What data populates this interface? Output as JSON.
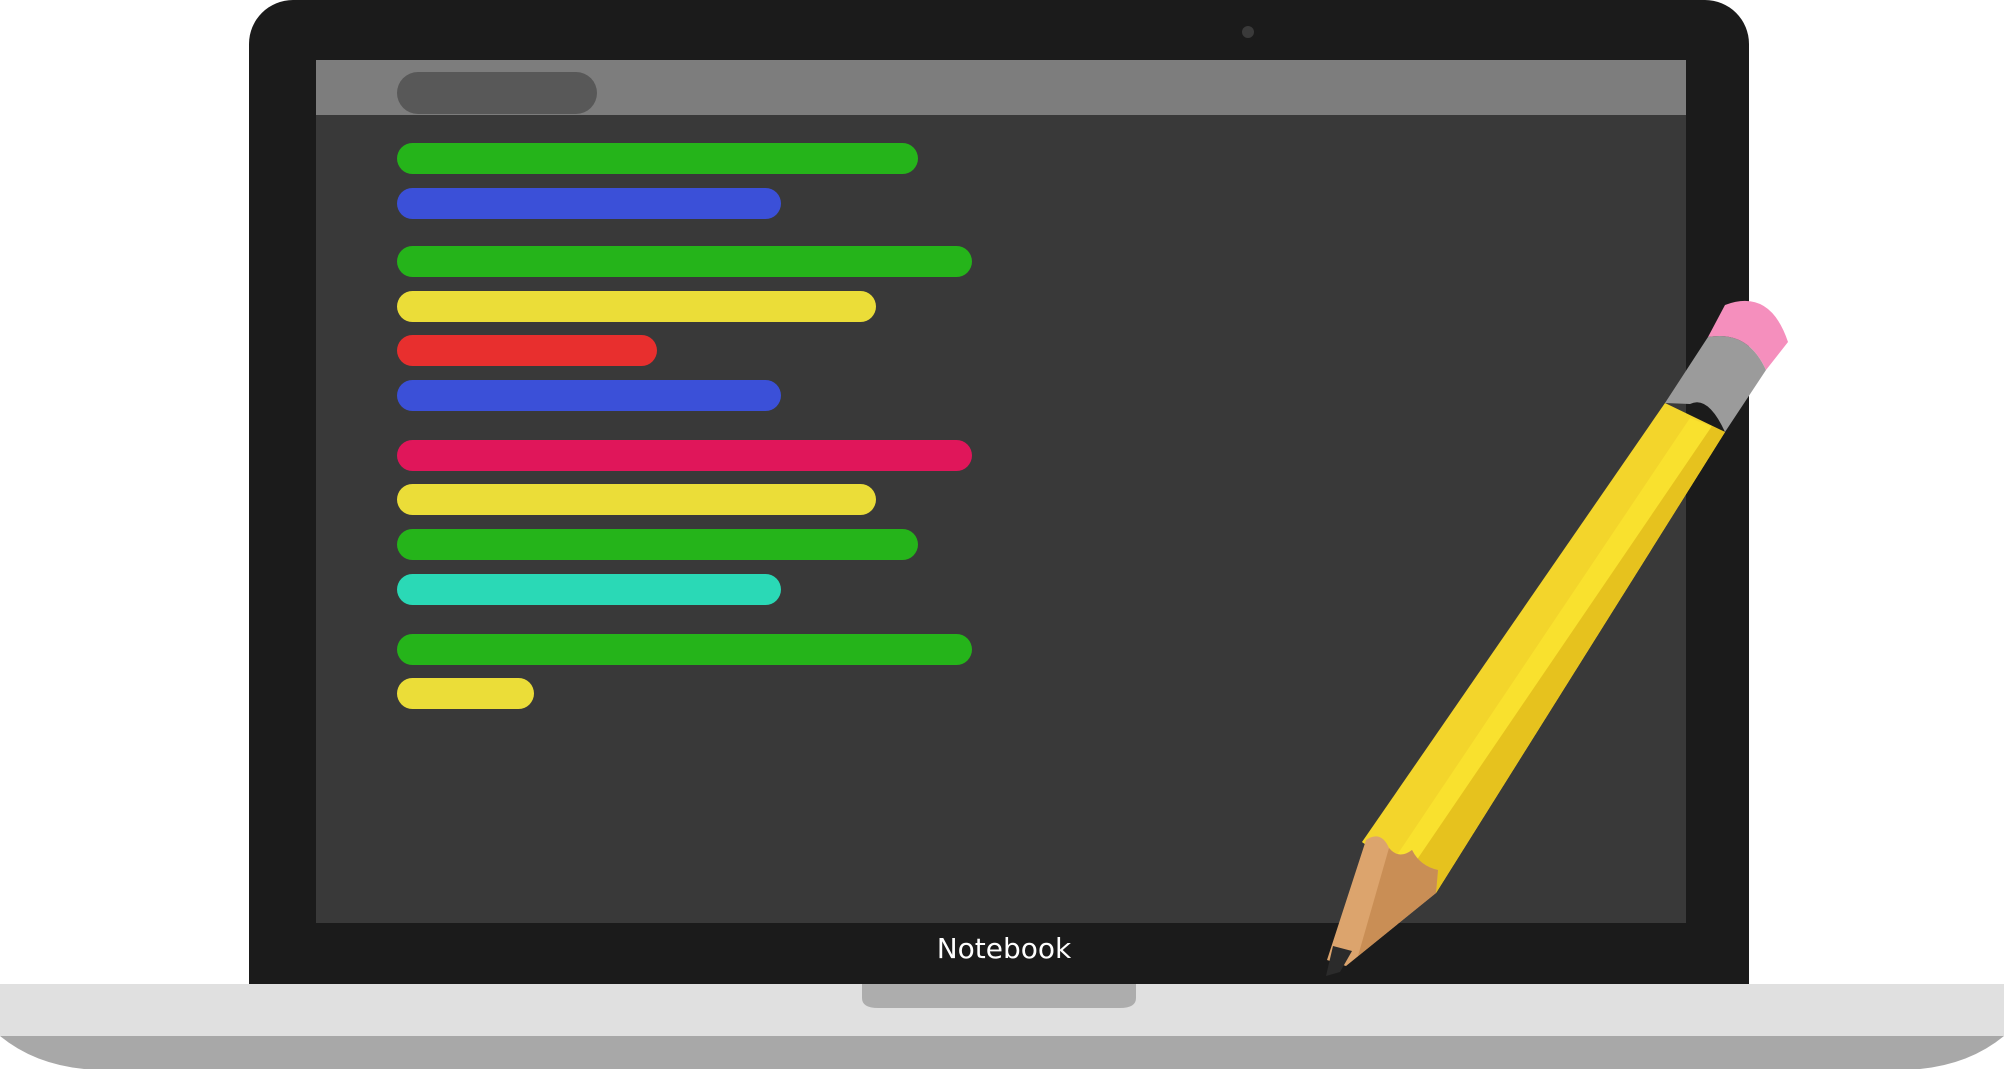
{
  "device": {
    "brand_label": "Notebook"
  },
  "colors": {
    "lid": "#1b1b1b",
    "screen": "#393939",
    "topbar": "#7d7d7d",
    "topbar_pill": "#585858",
    "base_top": "#e0e0e0",
    "base_bottom": "#a8a8a8",
    "pencil_body": "#f7e22a",
    "pencil_ferrule": "#9b9b9b",
    "pencil_eraser": "#f58fbd",
    "pencil_wood": "#dca46d",
    "pencil_lead": "#2b2b2b"
  },
  "code_lines": [
    {
      "color": "#25b41a",
      "length": 0.38
    },
    {
      "color": "#3b50d8",
      "length": 0.28
    },
    {
      "color": "#25b41a",
      "length": 0.42
    },
    {
      "color": "#ebdd38",
      "length": 0.35
    },
    {
      "color": "#e82f2e",
      "length": 0.19
    },
    {
      "color": "#3b50d8",
      "length": 0.28
    },
    {
      "color": "#e0165a",
      "length": 0.42
    },
    {
      "color": "#ebdd38",
      "length": 0.35
    },
    {
      "color": "#25b41a",
      "length": 0.38
    },
    {
      "color": "#2ad9b6",
      "length": 0.28
    },
    {
      "color": "#25b41a",
      "length": 0.42
    },
    {
      "color": "#ebdd38",
      "length": 0.1
    }
  ],
  "icons": {
    "camera": "camera-icon",
    "pencil": "pencil-icon",
    "trackpad": "trackpad-notch"
  }
}
